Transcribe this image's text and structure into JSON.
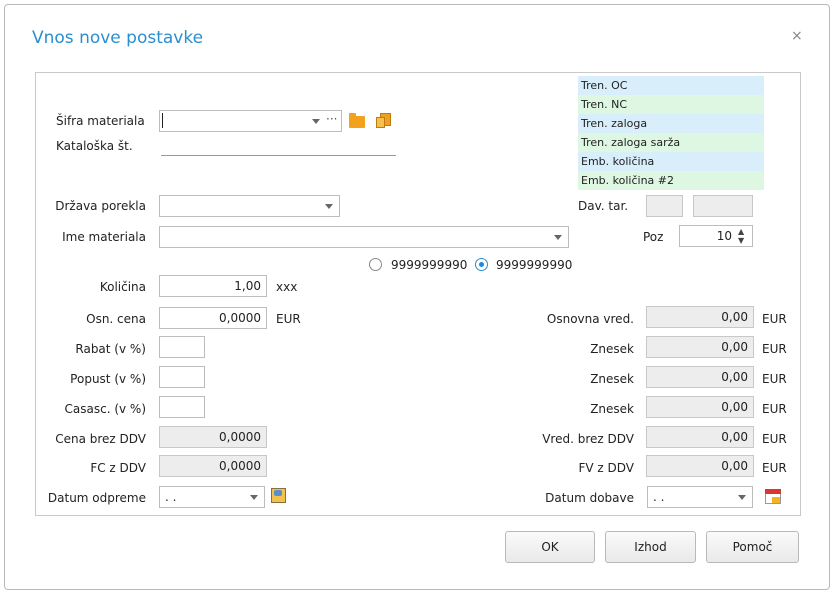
{
  "dialog": {
    "title": "Vnos nove postavke",
    "close_glyph": "×"
  },
  "fields": {
    "sifra_materiala_label": "Šifra materiala",
    "sifra_materiala_value": "",
    "ellipsis": "···",
    "kataloska_label": "Kataloška št.",
    "drzava_label": "Država porekla",
    "ime_label": "Ime materiala",
    "dav_tar_label": "Dav. tar.",
    "poz_label": "Poz",
    "poz_value": "10",
    "radio_1_label": "9999999990",
    "radio_2_label": "9999999990",
    "kolicina_label": "Količina",
    "kolicina_value": "1,00",
    "kolicina_unit": "xxx",
    "osn_cena_label": "Osn. cena",
    "osn_cena_value": "0,0000",
    "osn_cena_unit": "EUR",
    "rabat_label": "Rabat (v %)",
    "popust_label": "Popust (v %)",
    "casasc_label": "Casasc. (v %)",
    "cena_brez_ddv_label": "Cena brez DDV",
    "cena_brez_ddv_value": "0,0000",
    "fc_z_ddv_label": "FC z DDV",
    "fc_z_ddv_value": "0,0000",
    "datum_odpreme_label": "Datum odpreme",
    "datum_odpreme_value": ". .",
    "osnovna_vred_label": "Osnovna vred.",
    "osnovna_vred_value": "0,00",
    "znesek_1_label": "Znesek",
    "znesek_1_value": "0,00",
    "znesek_2_label": "Znesek",
    "znesek_2_value": "0,00",
    "znesek_3_label": "Znesek",
    "znesek_3_value": "0,00",
    "vred_brez_ddv_label": "Vred. brez DDV",
    "vred_brez_ddv_value": "0,00",
    "fv_z_ddv_label": "FV z DDV",
    "fv_z_ddv_value": "0,00",
    "currency": "EUR",
    "datum_dobave_label": "Datum dobave",
    "datum_dobave_value": ". ."
  },
  "info_list": [
    "Tren. OC",
    "Tren. NC",
    "Tren. zaloga",
    "Tren. zaloga sarža",
    "Emb. količina",
    "Emb. količina #2"
  ],
  "buttons": {
    "ok": "OK",
    "izhod": "Izhod",
    "pomoc": "Pomoč"
  },
  "colors": {
    "title": "#2a8fd0",
    "info_blue": "#d9eefb",
    "info_green": "#def7e3"
  }
}
